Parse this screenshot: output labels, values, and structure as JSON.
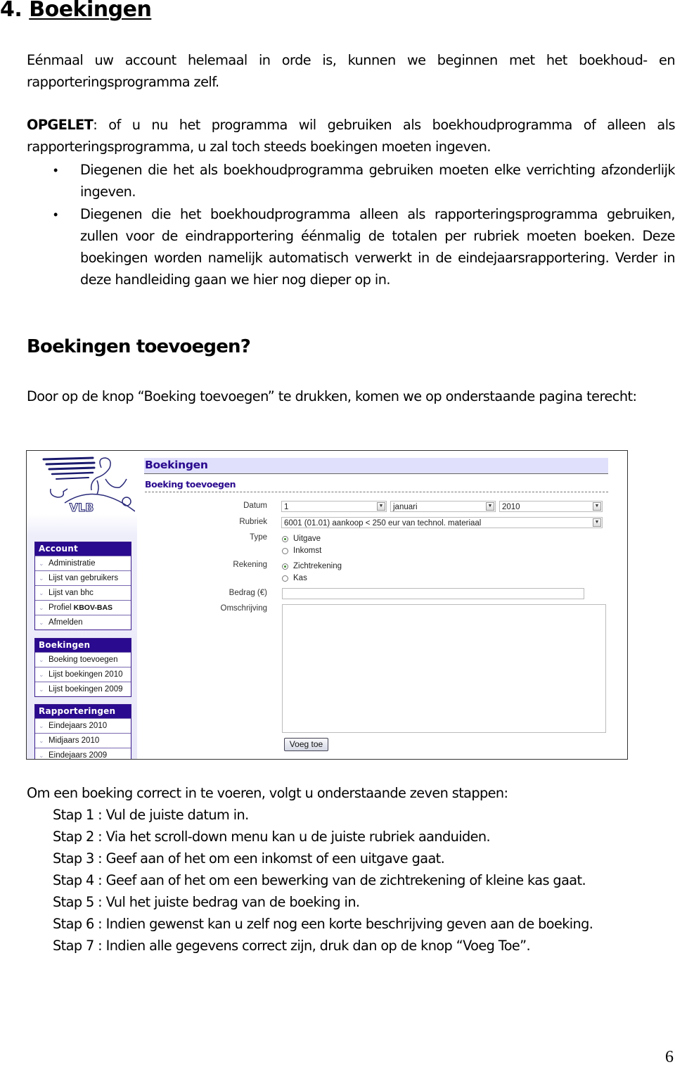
{
  "document": {
    "heading_number": "4.",
    "heading_title": "Boekingen",
    "intro": "Eénmaal uw account helemaal in orde is, kunnen we beginnen met het boekhoud- en rapporteringsprogramma zelf.",
    "warning_label": "OPGELET",
    "warning_text": ": of u nu het programma wil gebruiken als boekhoudprogramma of alleen als rapporteringsprogramma, u zal toch steeds boekingen moeten ingeven.",
    "bullets": [
      "Diegenen die het als boekhoudprogramma gebruiken moeten elke verrichting afzonderlijk ingeven.",
      "Diegenen die het boekhoudprogramma alleen als rapporteringsprogramma gebruiken, zullen voor de eindrapportering éénmalig de totalen per rubriek moeten boeken. Deze boekingen worden namelijk automatisch verwerkt in de eindejaarsrapportering. Verder in deze handleiding gaan we hier nog dieper op in."
    ],
    "subheading": "Boekingen toevoegen?",
    "lead": "Door op de knop “Boeking toevoegen” te drukken, komen we op onderstaande pagina terecht:",
    "steps_intro": "Om een boeking correct in te voeren, volgt u onderstaande zeven stappen:",
    "steps": [
      "Stap 1 : Vul de juiste datum in.",
      "Stap 2 : Via het scroll-down menu kan u de juiste rubriek aanduiden.",
      "Stap 3 : Geef aan of het om een inkomst of een uitgave gaat.",
      "Stap 4 : Geef aan of het om een bewerking van de zichtrekening of kleine kas gaat.",
      "Stap 5 : Vul het juiste bedrag van de boeking in.",
      "Stap 6 : Indien gewenst kan u zelf nog een korte beschrijving geven aan de boeking.",
      "Stap 7 : Indien alle gegevens correct zijn, druk dan op de knop “Voeg Toe”."
    ],
    "page_number": "6"
  },
  "screenshot": {
    "logo_text": "VLB",
    "colors": {
      "menu_header": "#2a0a8e",
      "title_bg": "#e0e0fc",
      "title_text": "#2a0a8e"
    },
    "sidebar": {
      "sections": [
        {
          "title": "Account",
          "items": [
            {
              "label": "Administratie"
            },
            {
              "label": "Lijst van gebruikers"
            },
            {
              "label": "Lijst van bhc"
            },
            {
              "label": "Profiel",
              "bold_suffix": "KBOV-BAS"
            },
            {
              "label": "Afmelden"
            }
          ]
        },
        {
          "title": "Boekingen",
          "items": [
            {
              "label": "Boeking toevoegen"
            },
            {
              "label": "Lijst boekingen 2010"
            },
            {
              "label": "Lijst boekingen 2009"
            }
          ]
        },
        {
          "title": "Rapporteringen",
          "items": [
            {
              "label": "Eindejaars 2010"
            },
            {
              "label": "Midjaars 2010"
            },
            {
              "label": "Eindejaars 2009"
            }
          ]
        }
      ]
    },
    "main": {
      "title": "Boekingen",
      "subtitle": "Boeking toevoegen",
      "form": {
        "datum_label": "Datum",
        "day_value": "1",
        "month_value": "januari",
        "year_value": "2010",
        "rubriek_label": "Rubriek",
        "rubriek_value": "6001 (01.01) aankoop < 250 eur van technol. materiaal",
        "type_label": "Type",
        "type_options": [
          {
            "label": "Uitgave",
            "checked": true
          },
          {
            "label": "Inkomst",
            "checked": false
          }
        ],
        "rekening_label": "Rekening",
        "rekening_options": [
          {
            "label": "Zichtrekening",
            "checked": true
          },
          {
            "label": "Kas",
            "checked": false
          }
        ],
        "bedrag_label": "Bedrag (€)",
        "bedrag_value": "",
        "omschrijving_label": "Omschrijving",
        "omschrijving_value": "",
        "submit_label": "Voeg toe"
      }
    }
  }
}
